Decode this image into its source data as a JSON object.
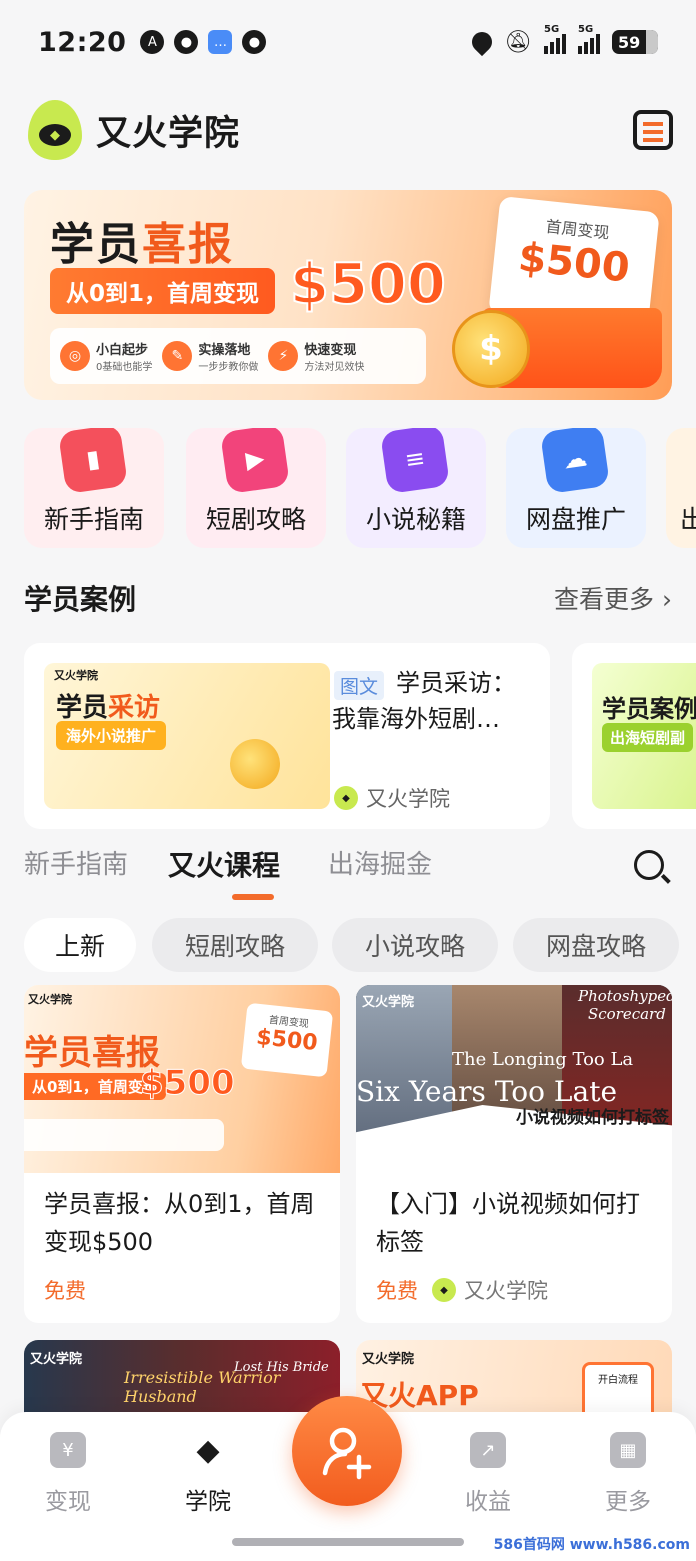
{
  "status_bar": {
    "time": "12:20",
    "battery": "59",
    "network1": "5G",
    "network2": "5G",
    "icons": [
      "auto-brightness-icon",
      "qq-icon",
      "message-icon",
      "qq-icon",
      "location-icon",
      "mute-icon"
    ]
  },
  "header": {
    "brand": "又火学院",
    "calendar_icon": "calendar-icon"
  },
  "banner": {
    "title_a": "学员",
    "title_b": "喜报",
    "strip": "从0到1，首周变现",
    "amount": "$500",
    "card_title": "首周变现",
    "card_value": "$500",
    "coin": "$",
    "features": [
      {
        "title": "小白起步",
        "sub": "0基础也能学"
      },
      {
        "title": "实操落地",
        "sub": "一步步教你做"
      },
      {
        "title": "快速变现",
        "sub": "方法对见效快"
      }
    ]
  },
  "categories": [
    {
      "label": "新手指南",
      "icon": "bookmark-icon",
      "color": "#f4505c",
      "bg": "#ffeef0"
    },
    {
      "label": "短剧攻略",
      "icon": "video-icon",
      "color": "#f2447b",
      "bg": "#ffecf2"
    },
    {
      "label": "小说秘籍",
      "icon": "book-icon",
      "color": "#8a4cf0",
      "bg": "#f3edff"
    },
    {
      "label": "网盘推广",
      "icon": "cloud-icon",
      "color": "#3f7ef2",
      "bg": "#ebf2ff"
    },
    {
      "label": "出",
      "icon": "globe-icon",
      "color": "#f39a2b",
      "bg": "#fff3e3"
    }
  ],
  "cases_section": {
    "title": "学员案例",
    "more": "查看更多 ›",
    "card": {
      "tag": "图文",
      "title": "学员采访：我靠海外短剧…",
      "author": "又火学院",
      "thumb_brand": "又火学院",
      "thumb_title_a": "学员",
      "thumb_title_b": "采访",
      "thumb_strip": "海外小说推广"
    },
    "card2": {
      "thumb_title": "学员案例",
      "thumb_strip": "出海短剧副"
    }
  },
  "tabs": [
    {
      "label": "新手指南",
      "active": false
    },
    {
      "label": "又火课程",
      "active": true
    },
    {
      "label": "出海掘金",
      "active": false
    }
  ],
  "chips": [
    {
      "label": "上新",
      "active": true
    },
    {
      "label": "短剧攻略",
      "active": false
    },
    {
      "label": "小说攻略",
      "active": false
    },
    {
      "label": "网盘攻略",
      "active": false
    }
  ],
  "courses": [
    {
      "title": "学员喜报：从0到1，首周变现$500",
      "price": "免费",
      "author": "",
      "img": {
        "brand": "又火学院",
        "a": "学员喜报",
        "b": "从0到1，首周变现",
        "c": "$500",
        "card_x": "首周变现",
        "card_y": "$500"
      }
    },
    {
      "title": "【入门】小说视频如何打标签",
      "price": "免费",
      "author": "又火学院",
      "img": {
        "brand": "又火学院",
        "sy": "Six Years Too Late",
        "lg": "The Longing Too La",
        "ps": "Photoshyped Scorecard",
        "ttl": "小说视频如何打标签"
      }
    },
    {
      "img": {
        "brand": "又火学院",
        "t": "Irresistible Warrior Husband",
        "u": "Lost His Bride"
      }
    },
    {
      "img": {
        "brand": "又火学院",
        "app": "又火APP",
        "phone": "开白流程"
      }
    }
  ],
  "nav": [
    {
      "label": "变现",
      "icon": "wallet-icon",
      "active": false
    },
    {
      "label": "学院",
      "icon": "graduation-cap-icon",
      "active": true
    },
    {
      "label": "收益",
      "icon": "chart-icon",
      "active": false
    },
    {
      "label": "更多",
      "icon": "grid-icon",
      "active": false
    }
  ],
  "fab_icon": "add-user-icon",
  "watermark": "586首码网 www.h586.com",
  "colors": {
    "accent": "#f36b2b",
    "brand_green": "#c8e94f"
  }
}
